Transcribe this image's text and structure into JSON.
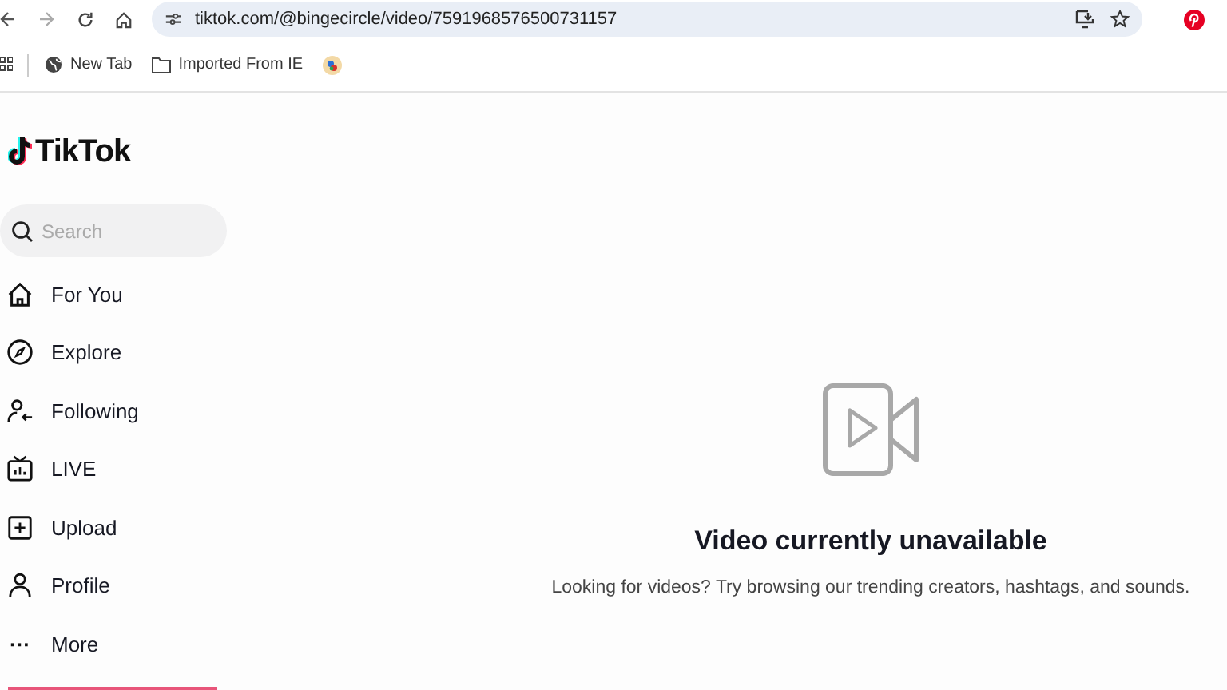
{
  "browser": {
    "url": "tiktok.com/@bingecircle/video/7591968576500731157",
    "bookmarks": [
      {
        "label": "New Tab",
        "kind": "globe"
      },
      {
        "label": "Imported From IE",
        "kind": "folder"
      },
      {
        "kind": "favicon"
      }
    ]
  },
  "sidebar": {
    "logo": "TikTok",
    "search": {
      "placeholder": "Search"
    },
    "items": [
      {
        "label": "For You"
      },
      {
        "label": "Explore"
      },
      {
        "label": "Following"
      },
      {
        "label": "LIVE"
      },
      {
        "label": "Upload"
      },
      {
        "label": "Profile"
      },
      {
        "label": "More",
        "icon_text": "···"
      }
    ]
  },
  "main": {
    "title": "Video currently unavailable",
    "message": "Looking for videos? Try browsing our trending creators, hashtags, and sounds."
  }
}
